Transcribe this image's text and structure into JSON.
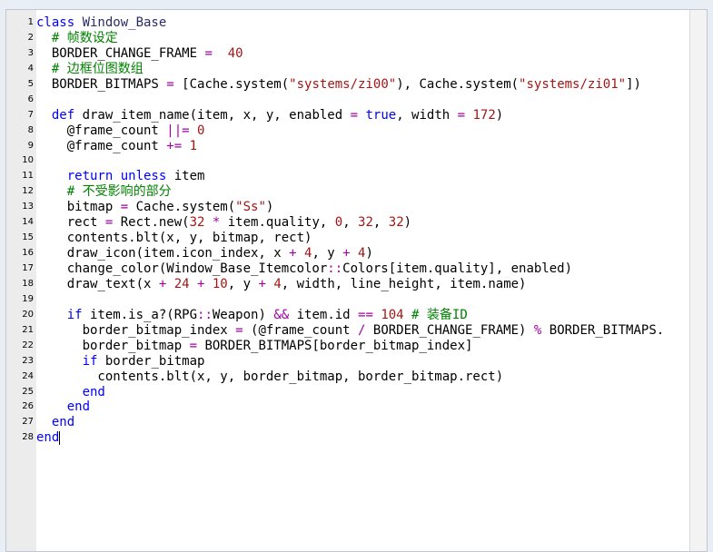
{
  "editor": {
    "lines": [
      {
        "n": "1",
        "segs": [
          [
            "kw",
            "class "
          ],
          [
            "cn",
            "Window_Base"
          ]
        ]
      },
      {
        "n": "2",
        "segs": [
          [
            "",
            "  "
          ],
          [
            "cm",
            "# 帧数设定"
          ]
        ]
      },
      {
        "n": "3",
        "segs": [
          [
            "",
            "  BORDER_CHANGE_FRAME "
          ],
          [
            "op",
            "="
          ],
          [
            "",
            "  "
          ],
          [
            "nm",
            "40"
          ]
        ]
      },
      {
        "n": "4",
        "segs": [
          [
            "",
            "  "
          ],
          [
            "cm",
            "# 边框位图数组"
          ]
        ]
      },
      {
        "n": "5",
        "segs": [
          [
            "",
            "  BORDER_BITMAPS "
          ],
          [
            "op",
            "="
          ],
          [
            "",
            [
              " ["
            ]
          ],
          [
            "",
            "Cache.system("
          ],
          [
            "st",
            "\"systems/zi00\""
          ],
          [
            "",
            "), Cache.system("
          ],
          [
            "st",
            "\"systems/zi01\""
          ],
          [
            "",
            "])"
          ]
        ]
      },
      {
        "n": "6",
        "segs": []
      },
      {
        "n": "7",
        "segs": [
          [
            "",
            "  "
          ],
          [
            "kw",
            "def "
          ],
          [
            "",
            "draw_item_name(item, x, y, enabled "
          ],
          [
            "op",
            "="
          ],
          [
            "",
            ""
          ],
          [
            "kw",
            " true"
          ],
          [
            "",
            ", width "
          ],
          [
            "op",
            "="
          ],
          [
            "",
            ""
          ],
          [
            "nm",
            " 172"
          ],
          [
            "",
            ")"
          ]
        ]
      },
      {
        "n": "8",
        "segs": [
          [
            "",
            "    @frame_count "
          ],
          [
            "op",
            "||="
          ],
          [
            "nm",
            " 0"
          ]
        ]
      },
      {
        "n": "9",
        "segs": [
          [
            "",
            "    @frame_count "
          ],
          [
            "op",
            "+="
          ],
          [
            "nm",
            " 1"
          ]
        ]
      },
      {
        "n": "10",
        "segs": []
      },
      {
        "n": "11",
        "segs": [
          [
            "",
            "    "
          ],
          [
            "kw",
            "return unless"
          ],
          [
            "",
            "",
            " item"
          ]
        ]
      },
      {
        "n": "12",
        "segs": [
          [
            "",
            "    "
          ],
          [
            "cm",
            "# 不受影响的部分"
          ]
        ]
      },
      {
        "n": "13",
        "segs": [
          [
            "",
            "    bitmap "
          ],
          [
            "op",
            "="
          ],
          [
            "",
            "",
            " Cache.system("
          ],
          [
            "st",
            "\"Ss\""
          ],
          [
            "",
            ")"
          ]
        ]
      },
      {
        "n": "14",
        "segs": [
          [
            "",
            "    rect "
          ],
          [
            "op",
            "="
          ],
          [
            "",
            "",
            " Rect.new("
          ],
          [
            "nm",
            "32"
          ],
          [
            "op",
            " *"
          ],
          [
            "",
            "",
            " item.quality, "
          ],
          [
            "nm",
            "0"
          ],
          [
            "",
            ", "
          ],
          [
            "nm",
            "32"
          ],
          [
            "",
            ", "
          ],
          [
            "nm",
            "32"
          ],
          [
            "",
            ")"
          ]
        ]
      },
      {
        "n": "15",
        "segs": [
          [
            "",
            "    contents.blt(x, y, bitmap, rect)"
          ]
        ]
      },
      {
        "n": "16",
        "segs": [
          [
            "",
            "    draw_icon(item.icon_index, x "
          ],
          [
            "op",
            "+"
          ],
          [
            "nm",
            " 4"
          ],
          [
            "",
            ", y "
          ],
          [
            "op",
            "+"
          ],
          [
            "nm",
            " 4"
          ],
          [
            "",
            ")"
          ]
        ]
      },
      {
        "n": "17",
        "segs": [
          [
            "",
            "    change_color(Window_Base_Itemcolor"
          ],
          [
            "op",
            "::"
          ],
          [
            "",
            "Colors[item.quality], enabled)"
          ]
        ]
      },
      {
        "n": "18",
        "segs": [
          [
            "",
            "    draw_text(x "
          ],
          [
            "op",
            "+"
          ],
          [
            "nm",
            " 24"
          ],
          [
            "op",
            " +"
          ],
          [
            "nm",
            " 10"
          ],
          [
            "",
            ", y "
          ],
          [
            "op",
            "+"
          ],
          [
            "nm",
            " 4"
          ],
          [
            "",
            ", width, line_height, item.name)"
          ]
        ]
      },
      {
        "n": "19",
        "segs": []
      },
      {
        "n": "20",
        "segs": [
          [
            "",
            "    "
          ],
          [
            "kw",
            "if"
          ],
          [
            "",
            "",
            " item.is_a?(RPG"
          ],
          [
            "op",
            "::"
          ],
          [
            "",
            "Weapon) "
          ],
          [
            "op",
            "&&"
          ],
          [
            "",
            "",
            " item.id "
          ],
          [
            "op",
            "=="
          ],
          [
            "nm",
            " 104"
          ],
          [
            "cm",
            " # 装备ID"
          ]
        ]
      },
      {
        "n": "21",
        "segs": [
          [
            "",
            "      border_bitmap_index "
          ],
          [
            "op",
            "="
          ],
          [
            "",
            "",
            " (@frame_count "
          ],
          [
            "op",
            "/"
          ],
          [
            "",
            "",
            " BORDER_CHANGE_FRAME) "
          ],
          [
            "op",
            "%"
          ],
          [
            "",
            "",
            " BORDER_BITMAPS."
          ]
        ]
      },
      {
        "n": "22",
        "segs": [
          [
            "",
            "      border_bitmap "
          ],
          [
            "op",
            "="
          ],
          [
            "",
            "",
            " BORDER_BITMAPS[border_bitmap_index]"
          ]
        ]
      },
      {
        "n": "23",
        "segs": [
          [
            "",
            "      "
          ],
          [
            "kw",
            "if"
          ],
          [
            "",
            "",
            " border_bitmap"
          ]
        ]
      },
      {
        "n": "24",
        "segs": [
          [
            "",
            "        contents.blt(x, y, border_bitmap, border_bitmap.rect)"
          ]
        ]
      },
      {
        "n": "25",
        "segs": [
          [
            "",
            "      "
          ],
          [
            "kw",
            "end"
          ]
        ]
      },
      {
        "n": "26",
        "segs": [
          [
            "",
            "    "
          ],
          [
            "kw",
            "end"
          ]
        ]
      },
      {
        "n": "27",
        "segs": [
          [
            "",
            "  "
          ],
          [
            "kw",
            "end"
          ]
        ]
      },
      {
        "n": "28",
        "segs": [
          [
            "kw",
            "end"
          ]
        ]
      }
    ]
  }
}
